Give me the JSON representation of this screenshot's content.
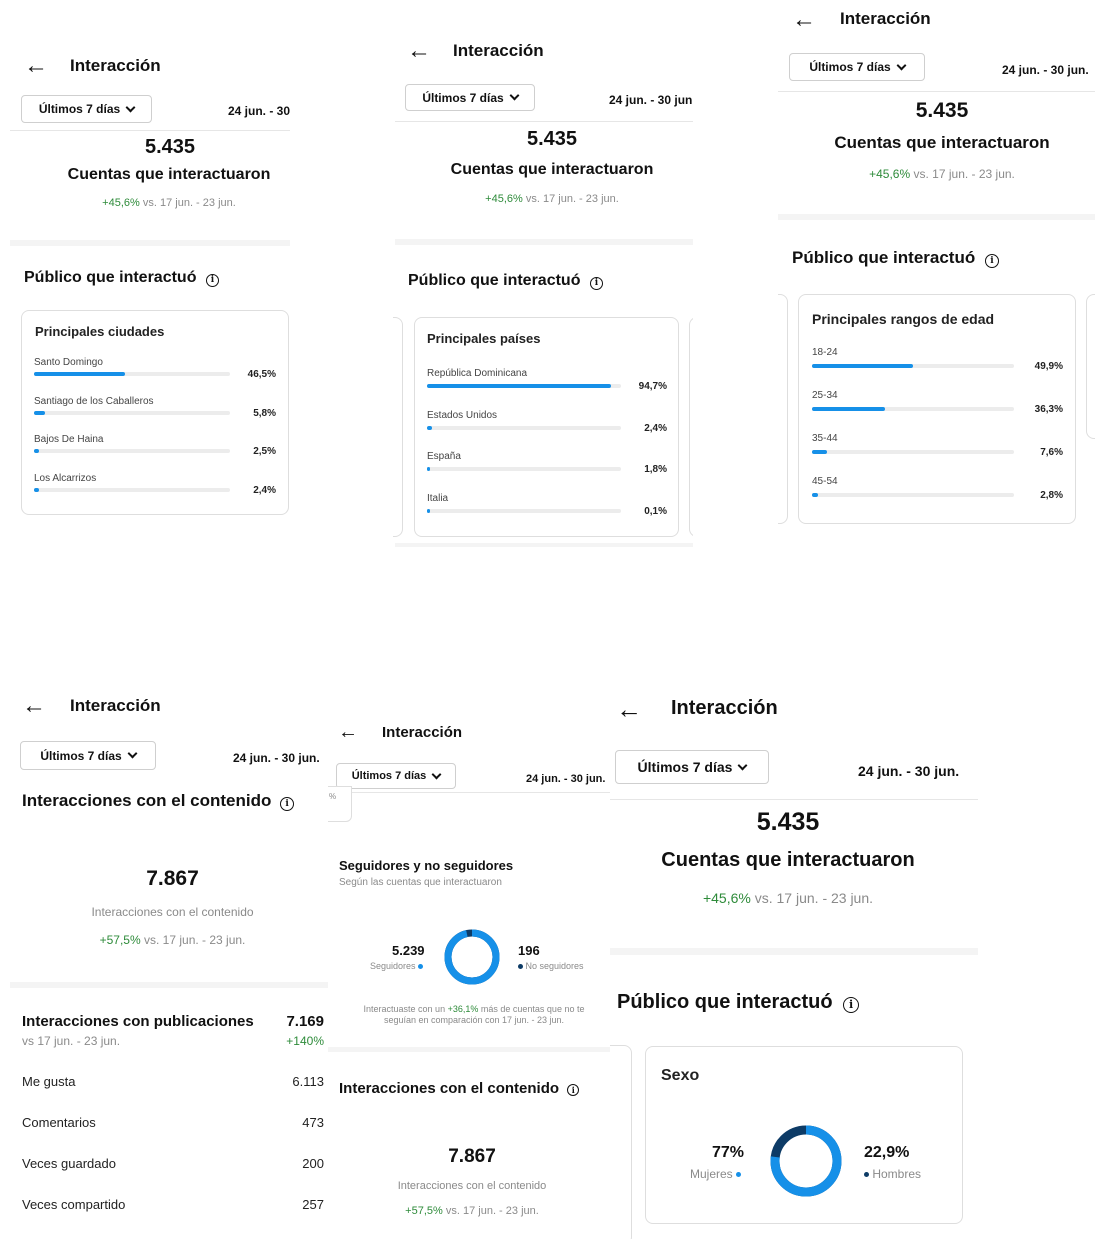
{
  "common": {
    "back_icon": "←",
    "title": "Interacción",
    "period": "Últimos 7 días",
    "date_range": "24 jun. - 30 jun.",
    "date_range_p1": "24 jun. - 30",
    "date_range_p2": "24 jun. - 30 jun",
    "accounts_value": "5.435",
    "accounts_label": "Cuentas que interactuaron",
    "change": "+45,6%",
    "vs": "vs. 17 jun. - 23 jun.",
    "audience_title": "Público que interactuó",
    "info_icon": "i"
  },
  "cities": {
    "title": "Principales ciudades",
    "items": [
      {
        "label": "Santo Domingo",
        "pct": "46,5%",
        "value": 46.5
      },
      {
        "label": "Santiago de los Caballeros",
        "pct": "5,8%",
        "value": 5.8
      },
      {
        "label": "Bajos De Haina",
        "pct": "2,5%",
        "value": 2.5
      },
      {
        "label": "Los Alcarrizos",
        "pct": "2,4%",
        "value": 2.4
      }
    ]
  },
  "countries": {
    "title": "Principales países",
    "items": [
      {
        "label": "República Dominicana",
        "pct": "94,7%",
        "value": 94.7
      },
      {
        "label": "Estados Unidos",
        "pct": "2,4%",
        "value": 2.4
      },
      {
        "label": "España",
        "pct": "1,8%",
        "value": 1.8
      },
      {
        "label": "Italia",
        "pct": "0,1%",
        "value": 0.1
      }
    ]
  },
  "ages": {
    "title": "Principales rangos de edad",
    "items": [
      {
        "label": "18-24",
        "pct": "49,9%",
        "value": 49.9
      },
      {
        "label": "25-34",
        "pct": "36,3%",
        "value": 36.3
      },
      {
        "label": "35-44",
        "pct": "7,6%",
        "value": 7.6
      },
      {
        "label": "45-54",
        "pct": "2,8%",
        "value": 2.8
      }
    ]
  },
  "content": {
    "title": "Interacciones con el contenido",
    "value": "7.867",
    "label": "Interacciones con el contenido",
    "change": "+57,5%",
    "vs": "vs. 17 jun. - 23 jun.",
    "posts_title": "Interacciones con publicaciones",
    "posts_value": "7.169",
    "posts_vs": "vs 17 jun. - 23 jun.",
    "posts_change": "+140%",
    "rows": [
      {
        "label": "Me gusta",
        "value": "6.113"
      },
      {
        "label": "Comentarios",
        "value": "473"
      },
      {
        "label": "Veces guardado",
        "value": "200"
      },
      {
        "label": "Veces compartido",
        "value": "257"
      }
    ]
  },
  "followers": {
    "fragment": "%",
    "title": "Seguidores y no seguidores",
    "subtitle": "Según las cuentas que interactuaron",
    "followers_value": "5.239",
    "followers_label": "Seguidores",
    "non_value": "196",
    "non_label": "No seguidores",
    "note_pre": "Interactuaste con un",
    "note_pct": "+36,1%",
    "note_post": "más de cuentas que no te",
    "note_line2": "seguían en comparación con 17 jun. - 23 jun.",
    "follower_fraction": 0.964
  },
  "gender": {
    "title": "Sexo",
    "women_pct": "77%",
    "women_label": "Mujeres",
    "men_pct": "22,9%",
    "men_label": "Hombres",
    "women_fraction": 0.77
  },
  "colors": {
    "accent_blue": "#1690e8",
    "dark_navy": "#0d3b66",
    "green": "#2e8b3a"
  }
}
